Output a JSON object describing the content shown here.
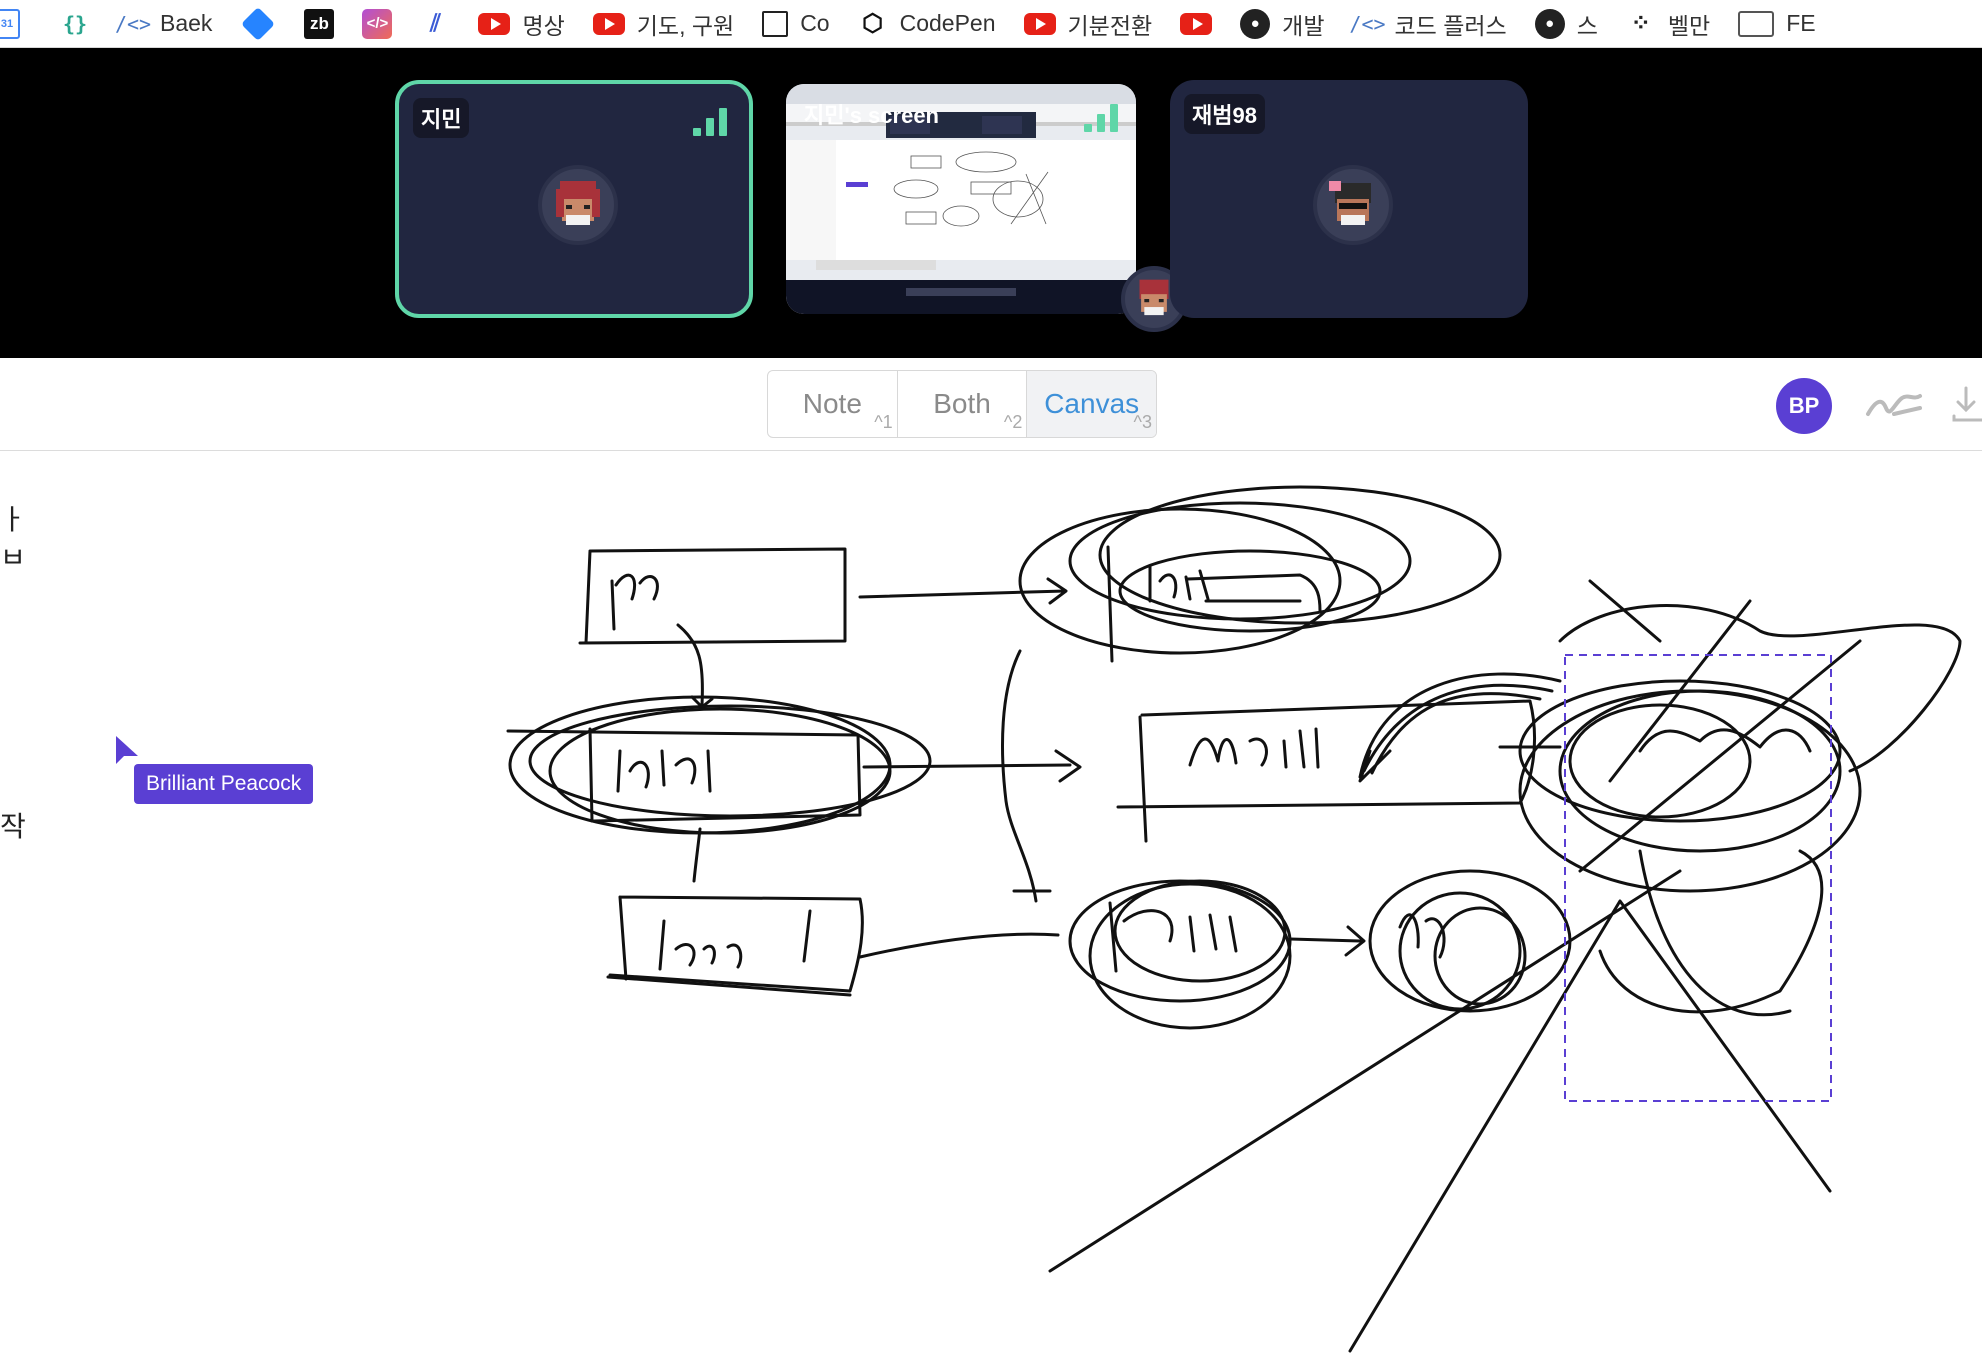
{
  "bookmarks": [
    {
      "icon": "calendar-icon",
      "label": ""
    },
    {
      "icon": "braces-icon",
      "label": ""
    },
    {
      "icon": "code-icon",
      "label": "Baek"
    },
    {
      "icon": "jira-diamond-icon",
      "label": ""
    },
    {
      "icon": "zb-icon",
      "label": ""
    },
    {
      "icon": "code-tag-icon",
      "label": ""
    },
    {
      "icon": "helix-icon",
      "label": ""
    },
    {
      "icon": "youtube-icon",
      "label": "명상"
    },
    {
      "icon": "youtube-icon",
      "label": "기도, 구원"
    },
    {
      "icon": "square-icon",
      "label": "Co"
    },
    {
      "icon": "codepen-icon",
      "label": "CodePen"
    },
    {
      "icon": "youtube-icon",
      "label": "기분전환"
    },
    {
      "icon": "youtube-icon",
      "label": ""
    },
    {
      "icon": "github-icon",
      "label": "개발"
    },
    {
      "icon": "code-icon",
      "label": "코드 플러스"
    },
    {
      "icon": "github-icon",
      "label": "스"
    },
    {
      "icon": "dots-icon",
      "label": "벨만"
    },
    {
      "icon": "folder-icon",
      "label": "FE"
    }
  ],
  "video": {
    "tiles": [
      {
        "name": "지민"
      },
      {
        "name": "지민's screen"
      },
      {
        "name": "재범98"
      }
    ]
  },
  "modes": {
    "items": [
      {
        "label": "Note",
        "shortcut": "^1"
      },
      {
        "label": "Both",
        "shortcut": "^2"
      },
      {
        "label": "Canvas",
        "shortcut": "^3"
      }
    ],
    "active": "Canvas"
  },
  "user": {
    "initials": "BP"
  },
  "note_fragments": [
    "ㅏ",
    "ㅂ",
    "작"
  ],
  "cursor": {
    "name": "Brilliant Peacock"
  },
  "colors": {
    "accent": "#5a3fd3",
    "active_tile": "#5fd6a8",
    "tile_bg": "#212640",
    "mode_active": "#3e90d8"
  }
}
